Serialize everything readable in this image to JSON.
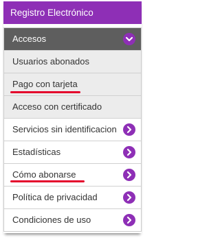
{
  "header": {
    "title": "Registro Electrónico"
  },
  "accordion": {
    "title": "Accesos",
    "icon": "chevron-down-icon",
    "submenu": [
      {
        "label": "Usuarios abonados"
      },
      {
        "label": "Pago con tarjeta"
      },
      {
        "label": "Acceso con certificado"
      }
    ]
  },
  "menu": [
    {
      "label": "Servicios sin identificacion",
      "icon": "chevron-right-icon"
    },
    {
      "label": "Estadísticas",
      "icon": "chevron-right-icon"
    },
    {
      "label": "Cómo abonarse",
      "icon": "chevron-right-icon"
    },
    {
      "label": "Política de privacidad",
      "icon": "chevron-right-icon"
    },
    {
      "label": "Condiciones de uso",
      "icon": "chevron-right-icon"
    }
  ],
  "colors": {
    "accent": "#8e2fb6",
    "accordion_bg": "#5e5e5e",
    "submenu_bg": "#ececec",
    "annotation": "#e4002b"
  }
}
